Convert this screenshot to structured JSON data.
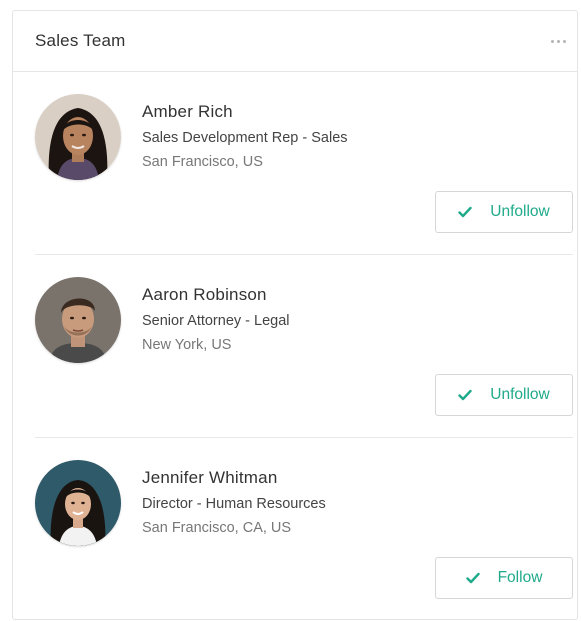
{
  "panel": {
    "title": "Sales Team",
    "more_icon": "more-horizontal-icon"
  },
  "accent_color": "#1faa8a",
  "people": [
    {
      "name": "Amber Rich",
      "role": "Sales Development Rep - Sales",
      "location": "San Francisco, US",
      "button_label": "Unfollow",
      "button_icon": "check-icon",
      "following": true
    },
    {
      "name": "Aaron Robinson",
      "role": "Senior Attorney - Legal",
      "location": "New York, US",
      "button_label": "Unfollow",
      "button_icon": "check-icon",
      "following": true
    },
    {
      "name": "Jennifer Whitman",
      "role": "Director - Human Resources",
      "location": "San Francisco, CA, US",
      "button_label": "Follow",
      "button_icon": "check-icon",
      "following": false
    }
  ]
}
